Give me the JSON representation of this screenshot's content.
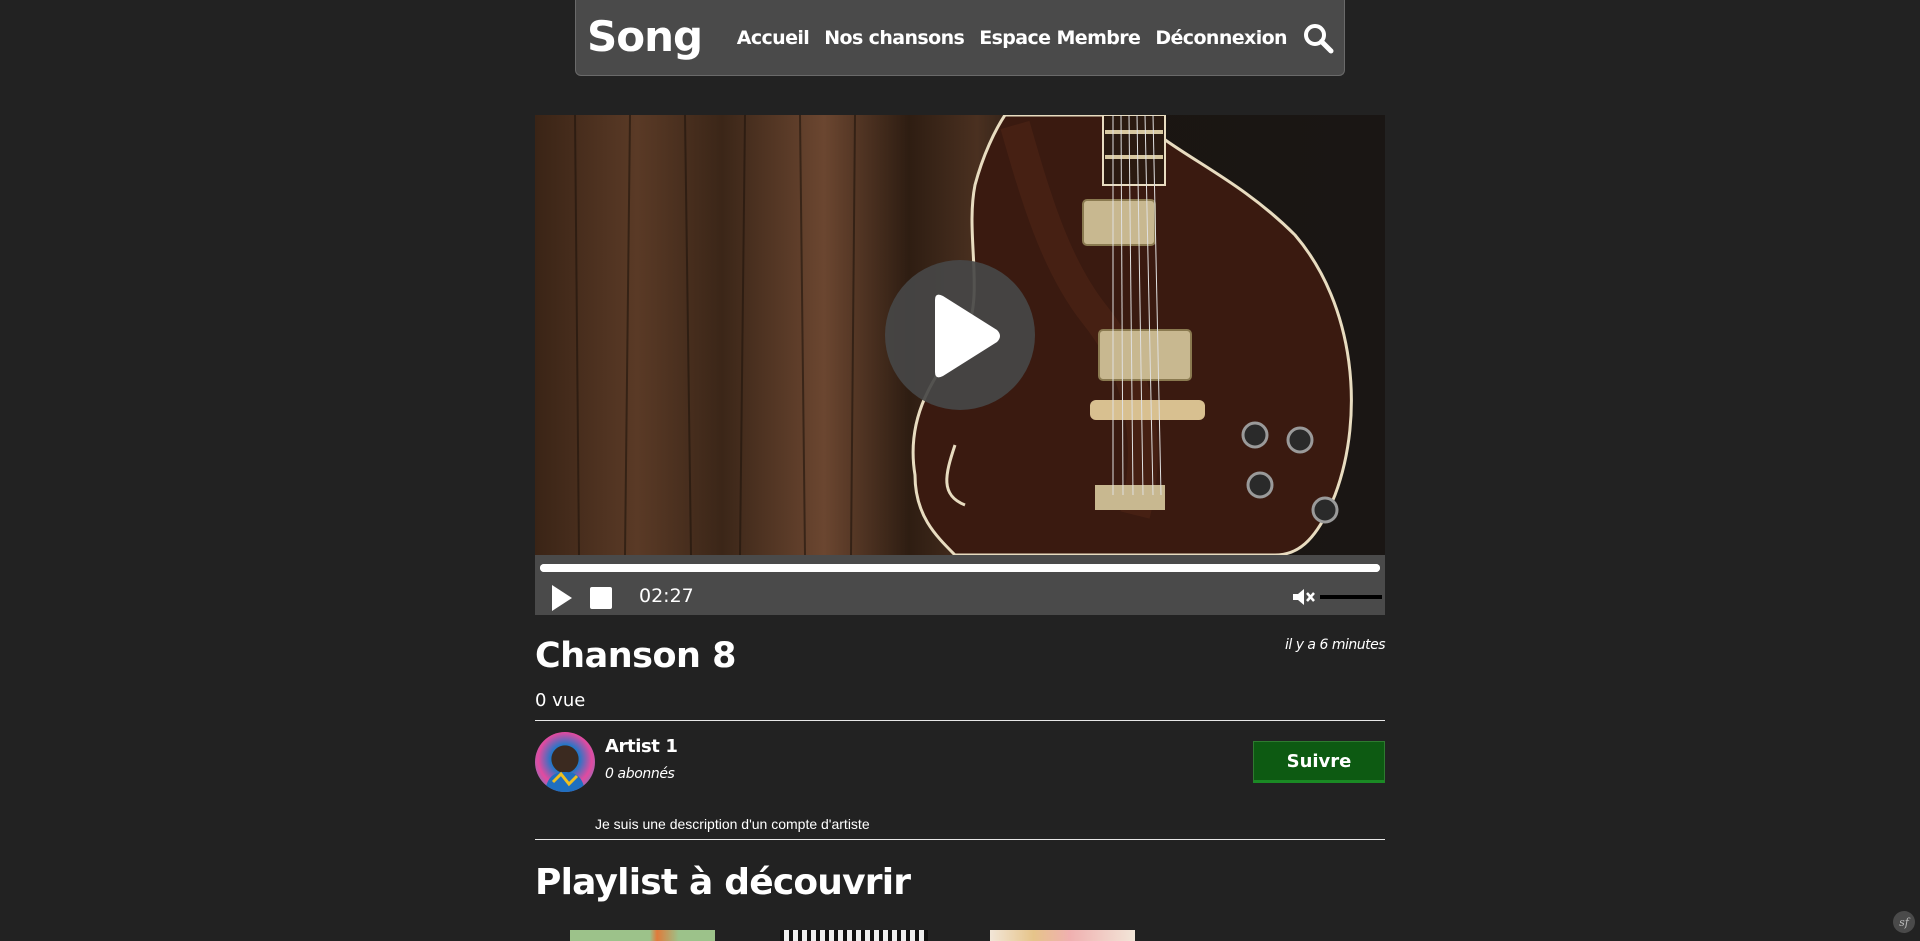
{
  "header": {
    "brand": "Song",
    "nav": [
      "Accueil",
      "Nos chansons",
      "Espace Membre",
      "Déconnexion"
    ],
    "search_icon": "search-icon"
  },
  "player": {
    "cover_image": "electric-guitar-on-wood",
    "big_play_icon": "play-icon",
    "progress": 1.0,
    "time": "02:27",
    "volume_muted": true,
    "volume_level": 1.0
  },
  "song": {
    "title": "Chanson 8",
    "posted": "il y a 6 minutes",
    "views": "0 vue"
  },
  "artist": {
    "name": "Artist 1",
    "subscribers": "0 abonnés",
    "follow_label": "Suivre",
    "description": "Je suis une description d'un compte d'artiste"
  },
  "playlists": {
    "title": "Playlist à découvrir"
  },
  "colors": {
    "background": "#222222",
    "navbar": "#4a4a4a",
    "follow_button": "#0d5a12"
  }
}
